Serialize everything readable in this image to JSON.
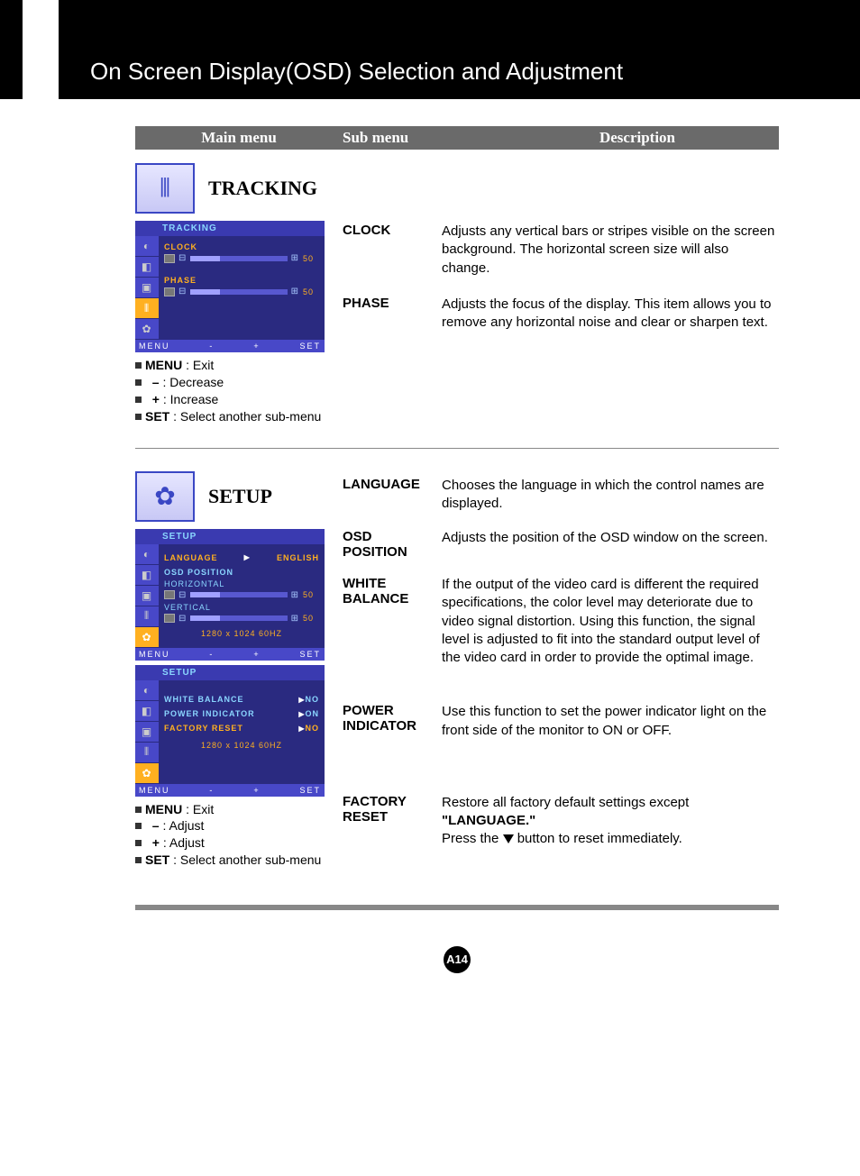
{
  "page": {
    "title": "On Screen Display(OSD) Selection and Adjustment",
    "number": "A14"
  },
  "columns": {
    "main": "Main menu",
    "sub": "Sub menu",
    "desc": "Description"
  },
  "tracking": {
    "title": "TRACKING",
    "osd": {
      "header": "TRACKING",
      "clock_label": "CLOCK",
      "clock_value": "50",
      "phase_label": "PHASE",
      "phase_value": "50",
      "footer_menu": "MENU",
      "footer_minus": "-",
      "footer_plus": "+",
      "footer_set": "SET"
    },
    "hints": {
      "menu": "MENU",
      "menu_desc": " : Exit",
      "minus": "–",
      "minus_desc": "  : Decrease",
      "plus": "+",
      "plus_desc": "  : Increase",
      "set": "SET",
      "set_desc": " : Select another sub-menu"
    },
    "items": {
      "clock_label": "CLOCK",
      "clock_desc": "Adjusts any vertical bars or stripes visible on the screen background. The horizontal screen size will also change.",
      "phase_label": "PHASE",
      "phase_desc": "Adjusts the focus of the display. This item allows you to remove any horizontal noise and clear or sharpen text."
    }
  },
  "setup": {
    "title": "SETUP",
    "osd1": {
      "header": "SETUP",
      "lang_label": "LANGUAGE",
      "lang_value": "ENGLISH",
      "osdpos_label": "OSD POSITION",
      "horiz_label": "HORIZONTAL",
      "horiz_value": "50",
      "vert_label": "VERTICAL",
      "vert_value": "50",
      "reso": "1280 x 1024  60HZ"
    },
    "osd2": {
      "header": "SETUP",
      "wb_label": "WHITE BALANCE",
      "wb_value": "NO",
      "pi_label": "POWER INDICATOR",
      "pi_value": "ON",
      "fr_label": "FACTORY RESET",
      "fr_value": "NO",
      "reso": "1280 x 1024  60HZ"
    },
    "hints": {
      "menu": "MENU",
      "menu_desc": " : Exit",
      "minus": "–",
      "minus_desc": "  : Adjust",
      "plus": "+",
      "plus_desc": "  : Adjust",
      "set": "SET",
      "set_desc": " : Select another sub-menu"
    },
    "items": {
      "language_label": "LANGUAGE",
      "language_desc": "Chooses the language in which the control names are displayed.",
      "osdpos_label": "OSD POSITION",
      "osdpos_desc": "Adjusts the position of the OSD window on the screen.",
      "wb_label": "WHITE BALANCE",
      "wb_desc": "If the output of the video card is different the required specifications, the color level may deteriorate due to video signal distortion. Using this function, the signal level is adjusted to fit into the standard output level of the video card in order to provide the optimal image.",
      "pi_label": "POWER INDICATOR",
      "pi_desc": "Use this function to set the power indicator light on the front side of the monitor to ON or OFF.",
      "fr_label": "FACTORY RESET",
      "fr_desc_1": "Restore all factory default settings except ",
      "fr_desc_bold": "\"LANGUAGE.\"",
      "fr_desc_2": "Press the ",
      "fr_desc_3": " button to reset immediately."
    }
  }
}
